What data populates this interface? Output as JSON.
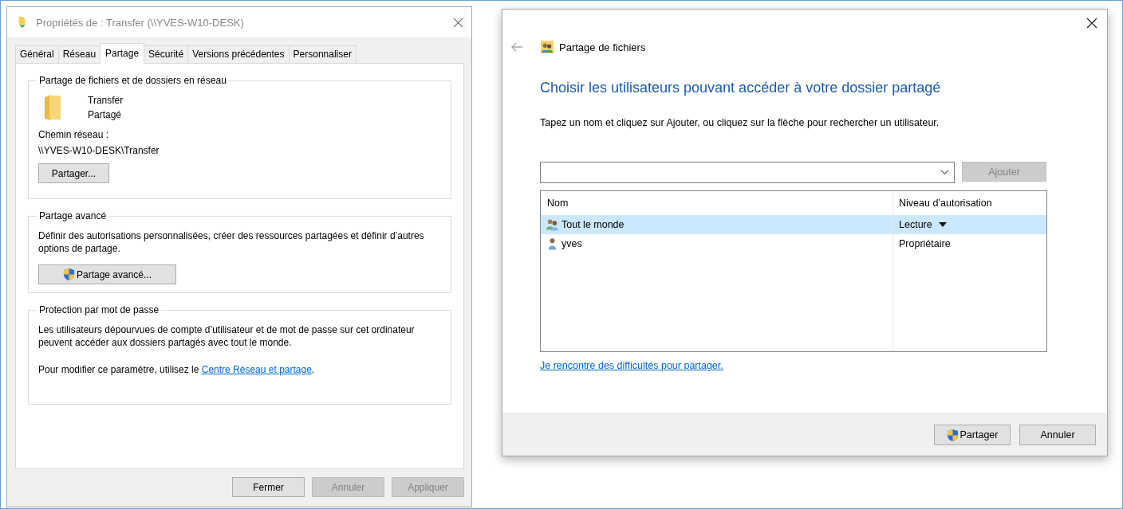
{
  "properties_dialog": {
    "title": "Propriétés de : Transfer (\\\\YVES-W10-DESK)",
    "tabs": [
      {
        "label": "Général",
        "selected": false
      },
      {
        "label": "Réseau",
        "selected": false
      },
      {
        "label": "Partage",
        "selected": true
      },
      {
        "label": "Sécurité",
        "selected": false
      },
      {
        "label": "Versions précédentes",
        "selected": false
      },
      {
        "label": "Personnaliser",
        "selected": false
      }
    ],
    "sharing_group": {
      "legend": "Partage de fichiers et de dossiers en réseau",
      "name": "Transfer",
      "status": "Partagé",
      "path_label": "Chemin réseau :",
      "path": "\\\\YVES-W10-DESK\\Transfer",
      "button": "Partager..."
    },
    "advanced_group": {
      "legend": "Partage avancé",
      "description": "Définir des autorisations personnalisées, créer des ressources partagées et définir d’autres options de partage.",
      "button": "Partage avancé..."
    },
    "password_group": {
      "legend": "Protection par mot de passe",
      "description": "Les utilisateurs dépourvues de compte d’utilisateur et de mot de passe sur cet ordinateur peuvent accéder aux dossiers partagés avec tout le monde.",
      "note": "Pour modifier ce paramètre, utilisez le ",
      "link": "Centre Réseau et partage",
      "note_end": "."
    },
    "buttons": [
      {
        "label": "Fermer",
        "disabled": false
      },
      {
        "label": "Annuler",
        "disabled": true
      },
      {
        "label": "Appliquer",
        "disabled": true
      }
    ]
  },
  "sharing_wizard": {
    "title": "Partage de fichiers",
    "heading": "Choisir les utilisateurs pouvant accéder à votre dossier partagé",
    "instruction": "Tapez un nom et cliquez sur Ajouter, ou cliquez sur la flèche pour rechercher un utilisateur.",
    "add_button": {
      "label": "Ajouter",
      "disabled": true
    },
    "columns": [
      "Nom",
      "Niveau d’autorisation"
    ],
    "rows": [
      {
        "kind": "group",
        "name": "Tout le monde",
        "permission": "Lecture",
        "dropdown": true,
        "selected": true
      },
      {
        "kind": "user",
        "name": "yves",
        "permission": "Propriétaire",
        "dropdown": false,
        "selected": false
      }
    ],
    "help_link": "Je rencontre des difficultés pour partager.",
    "buttons": [
      {
        "label": "Partager",
        "shield": true
      },
      {
        "label": "Annuler",
        "shield": false
      }
    ]
  }
}
